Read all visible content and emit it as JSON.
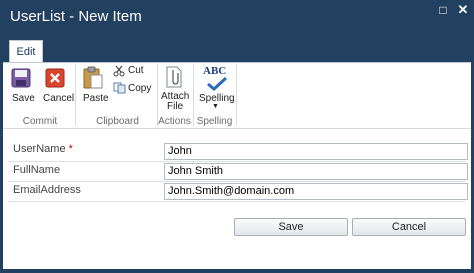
{
  "window": {
    "title": "UserList - New Item"
  },
  "tabs": [
    {
      "label": "Edit"
    }
  ],
  "ribbon": {
    "groups": {
      "commit": {
        "label": "Commit",
        "save": "Save",
        "cancel": "Cancel"
      },
      "clipboard": {
        "label": "Clipboard",
        "paste": "Paste",
        "cut": "Cut",
        "copy": "Copy"
      },
      "actions": {
        "label": "Actions",
        "attach_line1": "Attach",
        "attach_line2": "File"
      },
      "spelling": {
        "label": "Spelling",
        "spelling": "Spelling",
        "abc": "ABC"
      }
    }
  },
  "form": {
    "fields": [
      {
        "label": "UserName",
        "required_marker": "*",
        "value": "John"
      },
      {
        "label": "FullName",
        "value": "John Smith"
      },
      {
        "label": "EmailAddress",
        "value": "John.Smith@domain.com"
      }
    ],
    "save_label": "Save",
    "cancel_label": "Cancel"
  }
}
